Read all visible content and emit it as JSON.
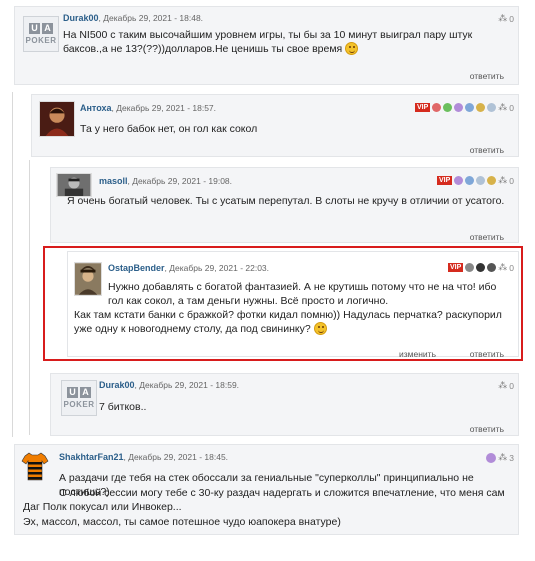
{
  "comments": [
    {
      "user": "Durak00",
      "date": "Декабрь 29, 2021 - 18:48.",
      "text": "На NI500 с таким высочайшим уровнем игры, ты бы за 10 минут выиграл пару штук баксов.,а не 13?(??))долларов.Не ценишь ты свое время",
      "count": "0",
      "reply": "ответить",
      "avatar": "ua-poker"
    },
    {
      "user": "Антоха",
      "date": "Декабрь 29, 2021 - 18:57.",
      "text": "Та у него бабок нет, он гол как сокол",
      "count": "0",
      "reply": "ответить",
      "badge": "VIP",
      "avatar": "photo"
    },
    {
      "user": "masoll",
      "date": "Декабрь 29, 2021 - 19:08.",
      "text": "Я очень богатый человек. Ты с усатым перепутал. В слоты не кручу в отличии от усатого.",
      "count": "0",
      "reply": "ответить",
      "badge": "VIP",
      "avatar": "photo"
    },
    {
      "user": "OstapBender",
      "date": "Декабрь 29, 2021 - 22:03.",
      "text_line1": "Нужно добавлять с богатой фантазией. А не крутишь потому что не на что! ибо гол как сокол, а там деньги нужны. Всё просто и логично.",
      "text_line2": "Как там кстати банки с бражкой? фотки кидал помню)) Надулась перчатка? раскупорил уже одну к новогоднему столу, да под свининку?",
      "count": "0",
      "edit": "изменить",
      "reply": "ответить",
      "badge": "VIP",
      "avatar": "photo"
    },
    {
      "user": "Durak00",
      "date": "Декабрь 29, 2021 - 18:59.",
      "text": "7 битков..",
      "count": "0",
      "reply": "ответить",
      "avatar": "ua-poker"
    },
    {
      "user": "ShakhtarFan21",
      "date": "Декабрь 29, 2021 - 18:45.",
      "text_line1": "А раздачи где тебя на стек обоссали за гениальные \"суперколлы\" принципиально не постишь?)",
      "text_line2": "С любой сессии могу тебе с 30-ку раздач надергать и сложится впечатление, что меня сам Даг Полк покусал или Инвокер...",
      "text_line3": "Эх, массол, массол, ты самое потешное чудо юапокера внатуре)",
      "count": "3",
      "avatar": "photo"
    }
  ],
  "ua_logo": {
    "top_left": "U",
    "top_right": "A",
    "bottom": "POKER"
  },
  "colors": {
    "vip": "#d52b1e",
    "username": "#2c5f8a",
    "highlight": "#d81c1c"
  }
}
